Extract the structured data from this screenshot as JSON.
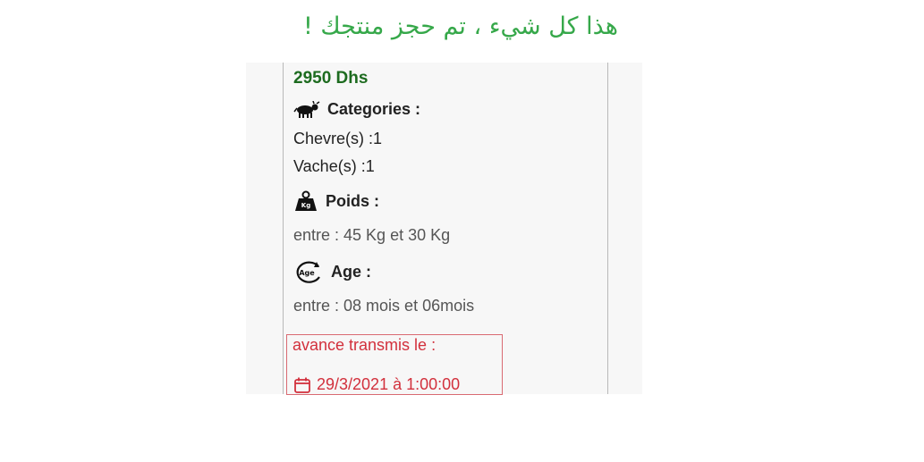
{
  "banner": {
    "text": "هذا كل شيء ، تم حجز منتجك !"
  },
  "price": "2950 Dhs",
  "categories": {
    "title": "Categories :",
    "icon": "livestock-icon",
    "items": [
      "Chevre(s) :1",
      "Vache(s) :1"
    ]
  },
  "poids": {
    "title": "Poids :",
    "icon": "weight-kg-icon",
    "icon_text": "Kg",
    "value": "entre : 45 Kg et 30 Kg"
  },
  "age": {
    "title": "Age :",
    "icon": "age-cycle-icon",
    "icon_text": "Age",
    "value": "entre : 08 mois et 06mois"
  },
  "advance": {
    "label": "avance transmis le :",
    "date": "29/3/2021 à 1:00:00",
    "icon": "calendar-icon"
  },
  "colors": {
    "banner": "#36a84a",
    "price": "#1d6b1f",
    "advance": "#d2303c"
  }
}
